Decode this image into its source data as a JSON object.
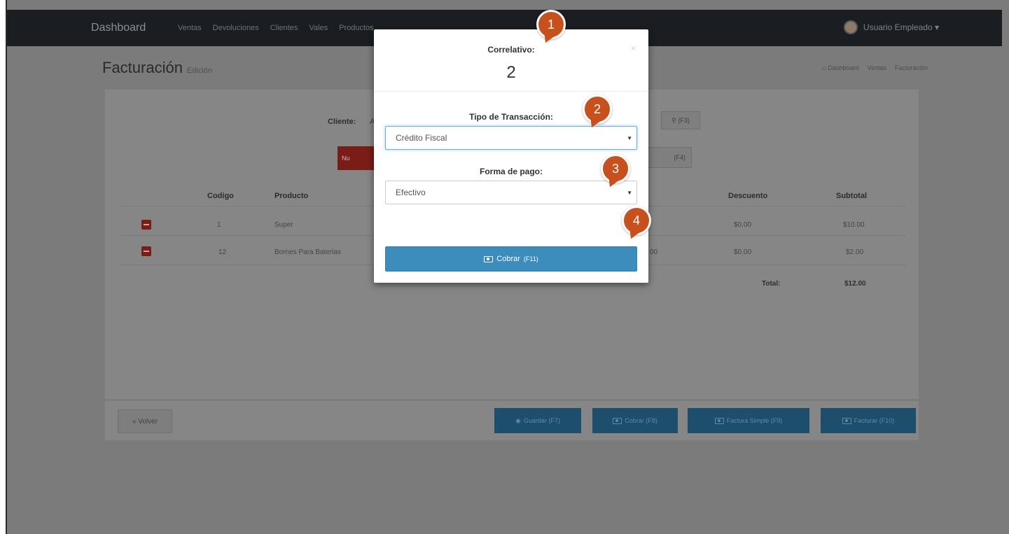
{
  "navbar": {
    "brand": "Dashboard",
    "links": [
      "Ventas",
      "Devoluciones",
      "Clientes",
      "Vales",
      "Productos"
    ],
    "user": "Usuario Empleado ▾"
  },
  "page": {
    "title": "Facturación",
    "subtitle": "Edición",
    "breadcrumb": [
      "Dashboard",
      "Ventas",
      "Facturación"
    ]
  },
  "form": {
    "cliente_label": "Cliente:",
    "cliente_value": "A",
    "search_label": "(F3)",
    "red_button_label": "Nu",
    "f4_button_label": "(F4)"
  },
  "table": {
    "headers": [
      "Codigo",
      "Producto",
      "Descuento",
      "Subtotal"
    ],
    "rows": [
      {
        "codigo": "1",
        "producto": "Super",
        "precio_frag": "",
        "descuento": "$0.00",
        "subtotal": "$10.00"
      },
      {
        "codigo": "12",
        "producto": "Bornes Para Baterias",
        "precio_frag": "00",
        "descuento": "$0.00",
        "subtotal": "$2.00"
      }
    ],
    "total_label": "Total:",
    "total_value": "$12.00"
  },
  "footer": {
    "back": "« Volver",
    "guardar": "Guardar (F7)",
    "cobrar": "Cobrar (F8)",
    "factura_simple": "Factura Simple (F9)",
    "facturar": "Facturar (F10)"
  },
  "modal": {
    "correlativo_label": "Correlativo:",
    "correlativo_value": "2",
    "close": "×",
    "tipo_label": "Tipo de Transacción:",
    "tipo_value": "Crédito Fiscal",
    "forma_label": "Forma de pago:",
    "forma_value": "Efectivo",
    "cobrar_label": "Cobrar",
    "cobrar_shortcut": "(F11)"
  },
  "markers": [
    "1",
    "2",
    "3",
    "4"
  ],
  "colors": {
    "marker": "#c8501c",
    "primary_button": "#3c8dbc",
    "navbar": "#1a1d22"
  }
}
